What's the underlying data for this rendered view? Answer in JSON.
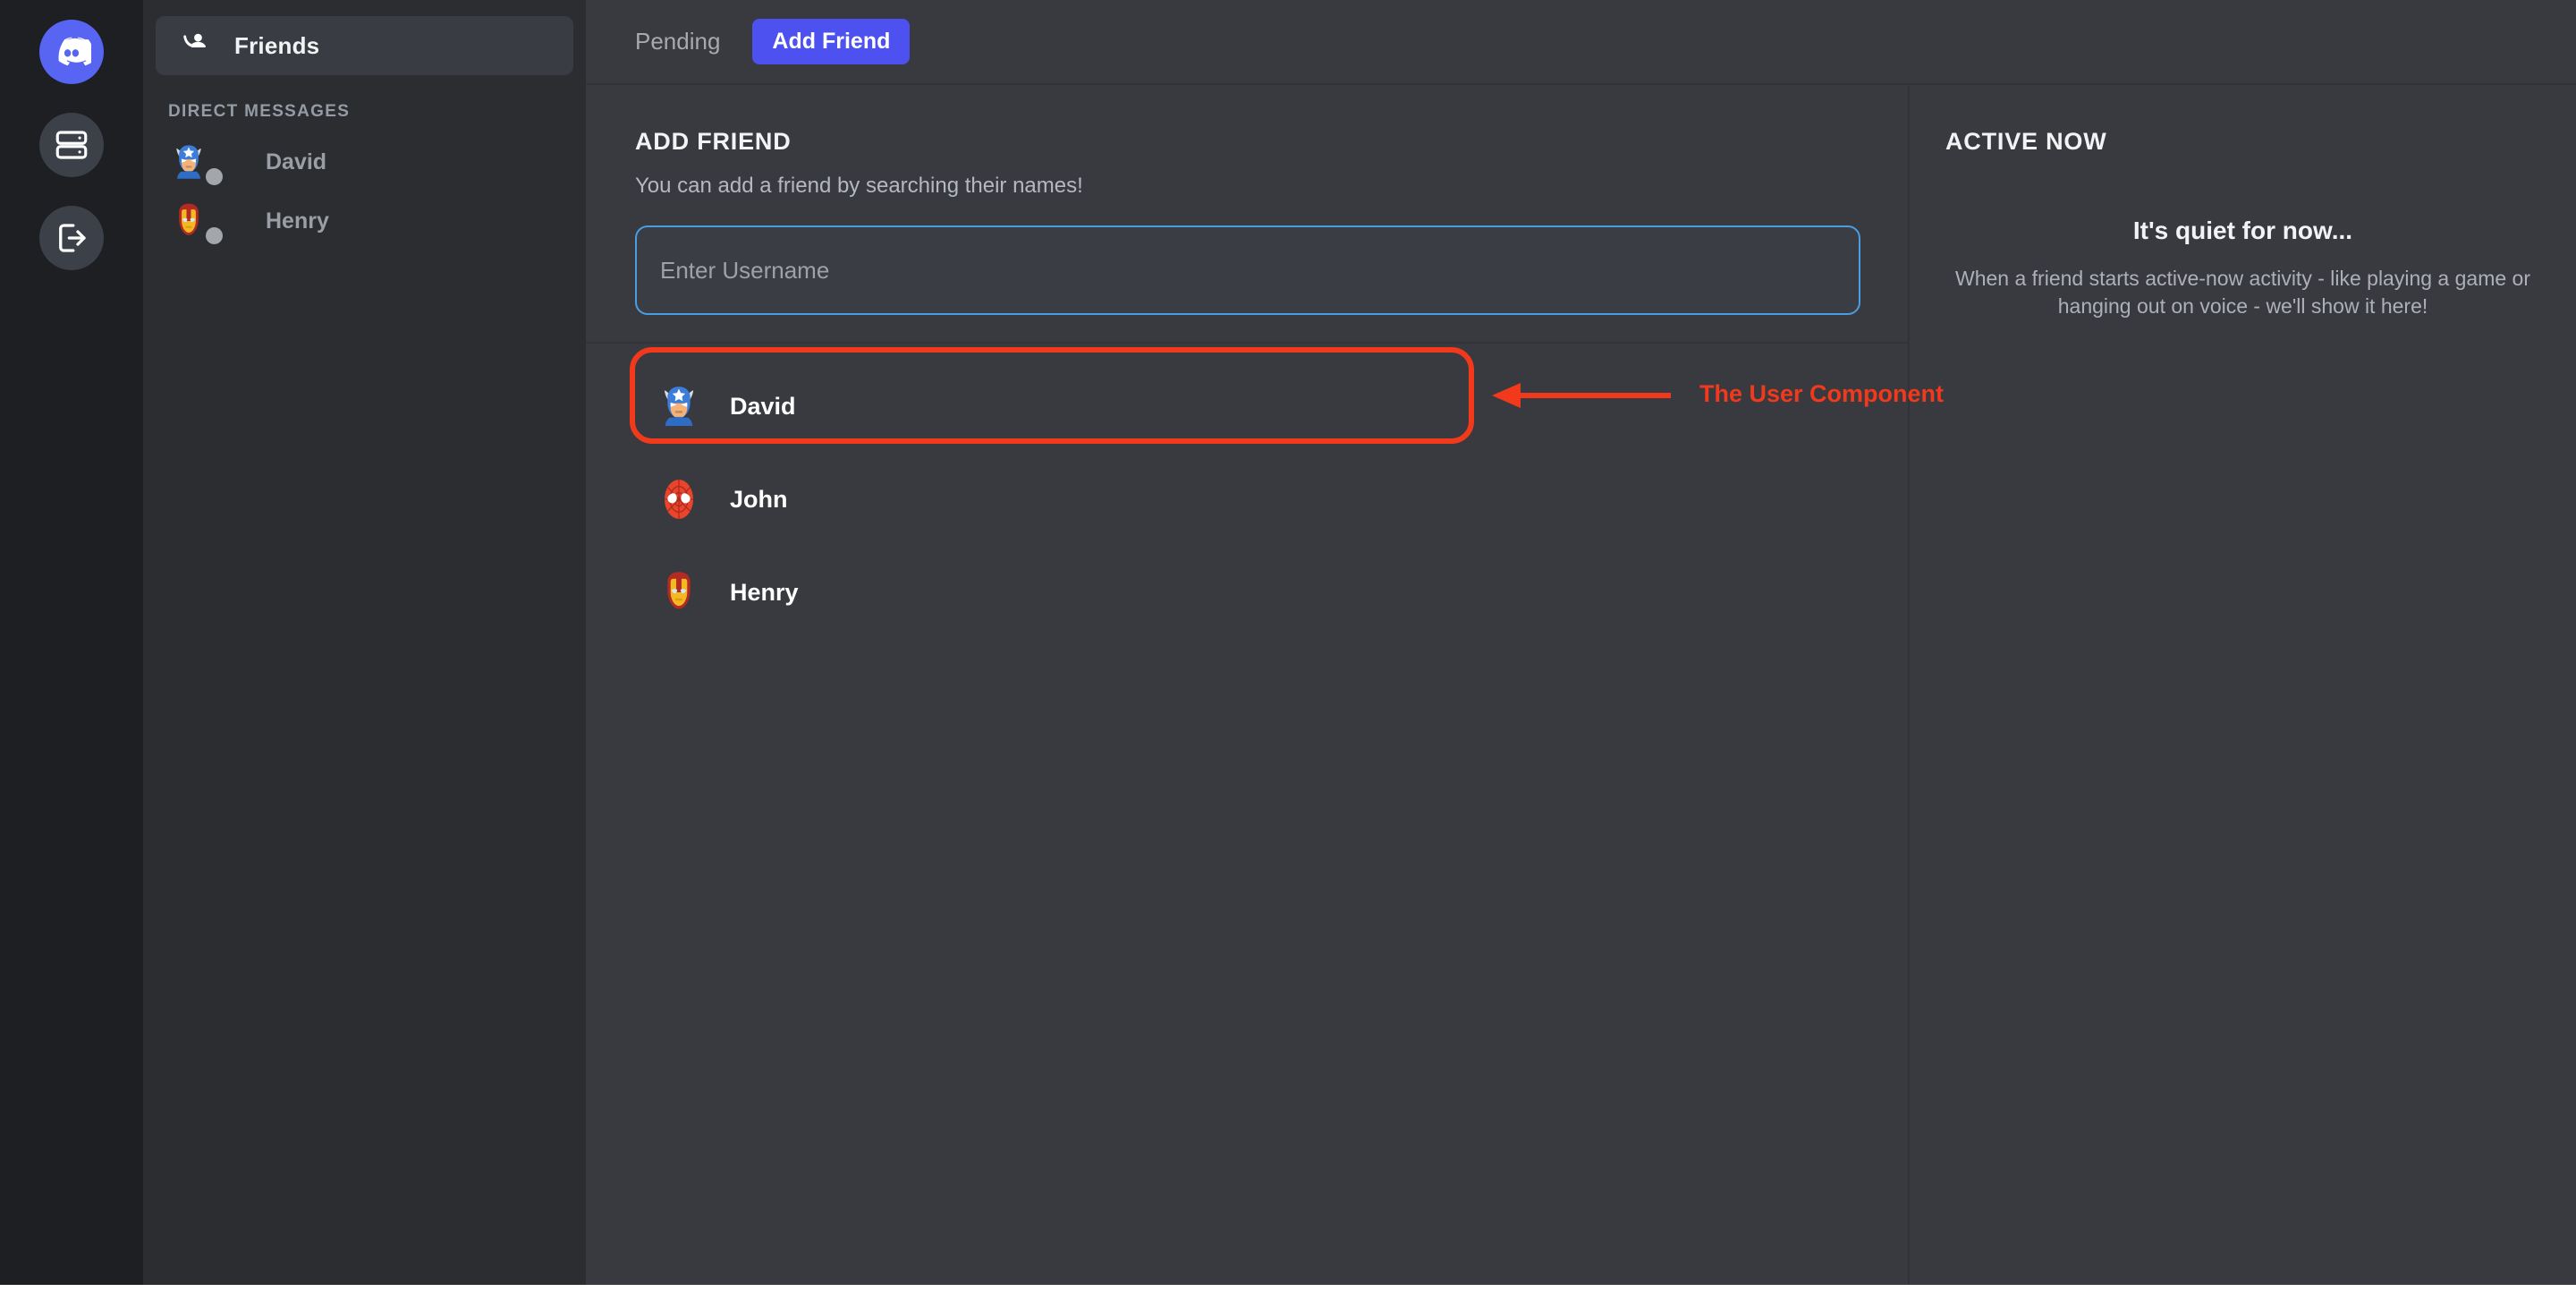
{
  "rail": {
    "items": [
      {
        "name": "discord-home",
        "icon": "discord-logo-icon",
        "active": true
      },
      {
        "name": "servers",
        "icon": "server-stack-icon",
        "active": false
      },
      {
        "name": "logout",
        "icon": "logout-icon",
        "active": false
      }
    ]
  },
  "sidebar": {
    "friends_label": "Friends",
    "friends_icon": "person-wave-icon",
    "dm_header": "DIRECT MESSAGES",
    "dms": [
      {
        "name": "David",
        "avatar": "captain-america-avatar",
        "status": "offline"
      },
      {
        "name": "Henry",
        "avatar": "iron-man-avatar",
        "status": "offline"
      }
    ]
  },
  "topbar": {
    "pending_label": "Pending",
    "add_friend_label": "Add Friend",
    "accent": "#4c51ef"
  },
  "add_friend": {
    "title": "ADD FRIEND",
    "subtitle": "You can add a friend by searching their names!",
    "input_value": "",
    "input_placeholder": "Enter Username",
    "input_border_color": "#4a9de0"
  },
  "results": [
    {
      "name": "David",
      "avatar": "captain-america-avatar",
      "highlighted": true
    },
    {
      "name": "John",
      "avatar": "spider-man-avatar",
      "highlighted": false
    },
    {
      "name": "Henry",
      "avatar": "iron-man-avatar",
      "highlighted": false
    }
  ],
  "active_now": {
    "title": "ACTIVE NOW",
    "empty_title": "It's quiet for now...",
    "empty_body": "When a friend starts active-now activity - like playing a game or hanging out on voice - we'll show it here!"
  },
  "annotation": {
    "label": "The User Component",
    "color": "#f2391c"
  }
}
